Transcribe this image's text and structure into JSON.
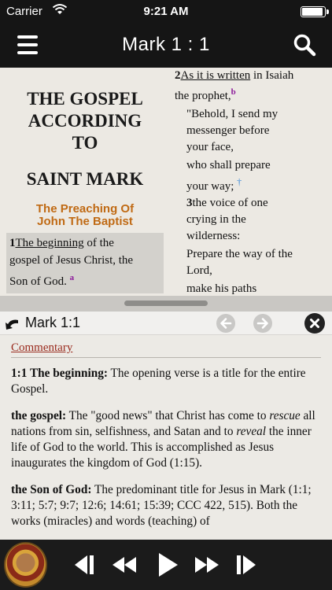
{
  "status_bar": {
    "carrier": "Carrier",
    "time": "9:21 AM",
    "battery_fraction": 0.95
  },
  "nav": {
    "title": "Mark  1 : 1"
  },
  "reader": {
    "book_title": [
      "THE GOSPEL",
      "ACCORDING",
      "TO",
      "SAINT MARK"
    ],
    "section_heading": [
      "The Preaching Of",
      "John The Baptist"
    ],
    "verse1": {
      "number": "1",
      "link_text": "The beginning",
      "text_a": " of the",
      "text_b": "gospel of Jesus Christ, the",
      "text_c": "Son of God.",
      "footnote": "a"
    },
    "verse2": {
      "number": "2",
      "link_text": "As it is written",
      "text_a": " in Isaiah",
      "text_b": "the prophet,",
      "footnote": "b",
      "quote_lines": [
        "\"Behold, I send my",
        "messenger before",
        "your face,",
        "who shall prepare",
        "your way;"
      ],
      "cross": "†"
    },
    "verse3": {
      "number": "3",
      "lines": [
        "the voice of one",
        "crying in the",
        "wilderness:",
        "Prepare the way of the",
        "Lord,",
        "make his paths"
      ]
    }
  },
  "commentary_header": {
    "reference": "Mark 1:1"
  },
  "commentary": {
    "label": "Commentary",
    "p1": {
      "term": "1:1 The beginning:",
      "text": " The opening verse is a title for the entire Gospel."
    },
    "p2": {
      "term": "the gospel:",
      "t1": " The \"good news\" that Christ has come to ",
      "em1": "rescue",
      "t2": " all nations from sin, selfishness, and Satan and to ",
      "em2": "reveal",
      "t3": " the inner life of God to the world. This is accomplished as Jesus inaugurates the kingdom of God (1:15)."
    },
    "p3": {
      "term": "the Son of God:",
      "text": " The predominant title for Jesus in Mark (1:1; 3:11; 5:7; 9:7; 12:6; 14:61; 15:39; CCC 422, 515). Both the works (miracles) and words (teaching) of"
    }
  },
  "icons": {
    "menu": "hamburger-icon",
    "search": "search-icon",
    "back": "chevron-left-icon",
    "forward": "chevron-right-icon",
    "close": "close-icon",
    "previous": "skip-previous-icon",
    "rewind": "rewind-icon",
    "play": "play-icon",
    "fast_forward": "fast-forward-icon",
    "next": "skip-next-icon"
  },
  "colors": {
    "nav_bg": "#151515",
    "section_heading": "#c06a14",
    "footnote": "#8c1a9a",
    "commentary_label": "#9a2b1e"
  }
}
